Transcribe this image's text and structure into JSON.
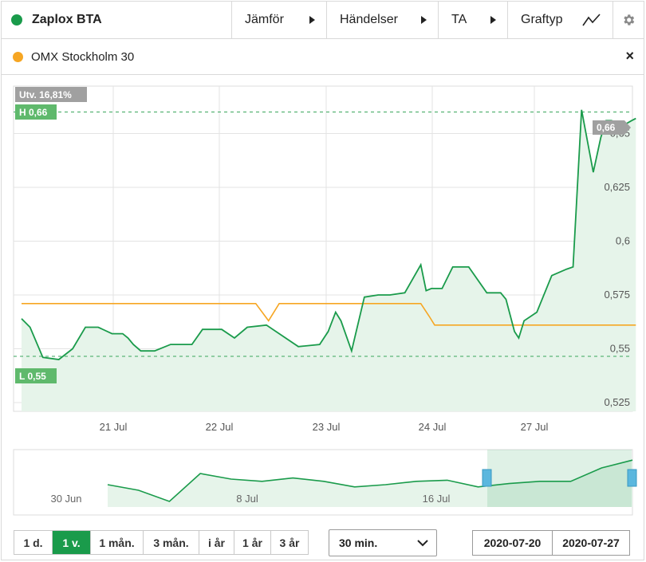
{
  "toolbar": {
    "title": "Zaplox BTA",
    "compare_label": "Jämför",
    "events_label": "Händelser",
    "ta_label": "TA",
    "charttype_label": "Graftyp",
    "settings_icon": "gear-icon",
    "charttype_icon": "line-chart-icon"
  },
  "legend": {
    "compare_series": "OMX Stockholm 30",
    "close_label": "×"
  },
  "badges": {
    "change": "Utv. 16,81%",
    "high": "H 0,66",
    "low": "L 0,55",
    "last": "0,66"
  },
  "colors": {
    "price_line": "#1a9b4b",
    "price_fill": "#e6f4ea",
    "index_line": "#f6a623",
    "accent": "#1a9b4b",
    "badge_gray": "#a0a0a0",
    "badge_green": "#5fb96c"
  },
  "chart_data": [
    {
      "type": "line",
      "x_tick_labels": [
        "21 Jul",
        "22 Jul",
        "23 Jul",
        "24 Jul",
        "27 Jul"
      ],
      "y_tick_labels": [
        "0,525",
        "0,55",
        "0,575",
        "0,6",
        "0,625",
        "0,65"
      ],
      "ylim": [
        0.525,
        0.675
      ],
      "grid": true,
      "high_line": 0.66,
      "low_line": 0.5465,
      "series": [
        {
          "name": "Zaplox BTA",
          "x_session": [
            0,
            0.08,
            0.2,
            0.35,
            0.48,
            0.6,
            0.72,
            0.85,
            0.95,
            1.0,
            1.05,
            1.12,
            1.25,
            1.4,
            1.5,
            1.6,
            1.7,
            1.88,
            2.0,
            2.12,
            2.3,
            2.6,
            2.8,
            2.88,
            2.95,
            3.0,
            3.1,
            3.22,
            3.35,
            3.46,
            3.6,
            3.75,
            3.8,
            3.85,
            3.95,
            4.05,
            4.2,
            4.37,
            4.5,
            4.55,
            4.63,
            4.67,
            4.72,
            4.84,
            4.98,
            5.12,
            5.18,
            5.26,
            5.37,
            5.44,
            5.49,
            5.54,
            5.66,
            5.73,
            5.77
          ],
          "values": [
            0.564,
            0.56,
            0.546,
            0.545,
            0.55,
            0.56,
            0.56,
            0.557,
            0.557,
            0.555,
            0.552,
            0.549,
            0.549,
            0.552,
            0.552,
            0.552,
            0.559,
            0.559,
            0.555,
            0.56,
            0.561,
            0.551,
            0.552,
            0.558,
            0.567,
            0.563,
            0.549,
            0.574,
            0.575,
            0.575,
            0.576,
            0.589,
            0.577,
            0.578,
            0.578,
            0.588,
            0.588,
            0.576,
            0.576,
            0.573,
            0.558,
            0.555,
            0.563,
            0.567,
            0.584,
            0.587,
            0.588,
            0.661,
            0.632,
            0.648,
            0.656,
            0.656,
            0.654,
            0.656,
            0.657
          ],
          "note_x": "x in trading-session units: 0 = session start before '21 Jul' tick"
        },
        {
          "name": "OMX Stockholm 30",
          "x_session": [
            0,
            2.2,
            2.32,
            2.42,
            2.5,
            3.75,
            3.83,
            3.88,
            5.77
          ],
          "values": [
            0.571,
            0.571,
            0.563,
            0.571,
            0.571,
            0.571,
            0.565,
            0.561,
            0.561
          ]
        }
      ]
    },
    {
      "type": "area",
      "x_tick_labels": [
        "30 Jun",
        "8 Jul",
        "16 Jul"
      ],
      "selected_range": [
        "2020-07-20",
        "2020-07-27"
      ],
      "series": [
        {
          "name": "Zaplox BTA",
          "values": [
            0.55,
            0.545,
            0.535,
            0.56,
            0.555,
            0.553,
            0.556,
            0.553,
            0.548,
            0.55,
            0.553,
            0.554,
            0.548,
            0.551,
            0.553,
            0.553,
            0.565,
            0.572
          ]
        }
      ]
    }
  ],
  "controls": {
    "ranges": [
      "1 d.",
      "1 v.",
      "1 mån.",
      "3 mån.",
      "i år",
      "1 år",
      "3 år"
    ],
    "active_range": "1 v.",
    "interval_value": "30 min.",
    "date_from": "2020-07-20",
    "date_to": "2020-07-27"
  }
}
